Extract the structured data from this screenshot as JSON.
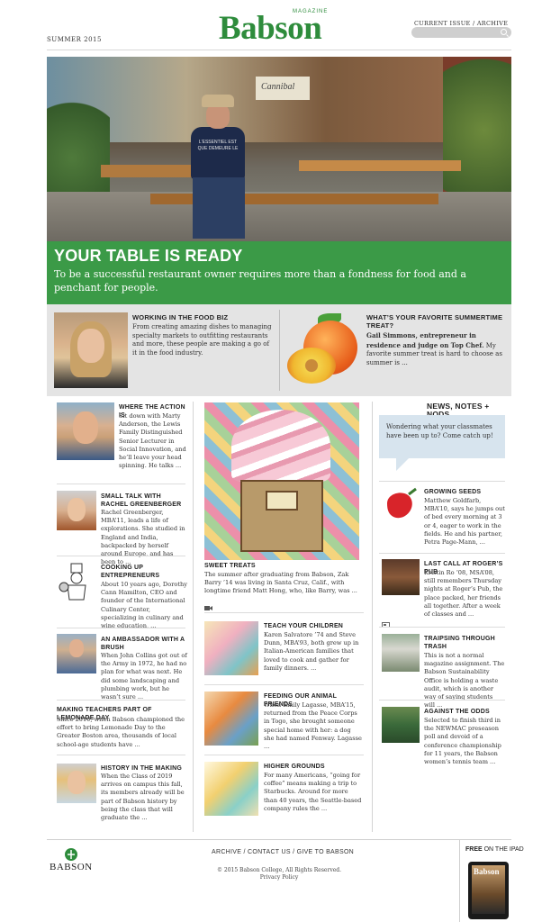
{
  "header": {
    "issue_date": "SUMMER 2015",
    "logo_magazine": "MAGAZINE",
    "logo_name": "Babson",
    "current_issue": "CURRENT ISSUE",
    "link_sep": "/",
    "archive": "ARCHIVE",
    "search_placeholder": ""
  },
  "hero": {
    "sign_text": "Cannibal",
    "shirt_text": "L'ESSENTIEL EST QUE DEMEURE LE",
    "title": "YOUR TABLE IS READY",
    "subtitle": "To be a successful restaurant owner requires more than a fondness for food and a penchant for people."
  },
  "features": [
    {
      "title": "WORKING IN THE FOOD BIZ",
      "text": "From creating amazing dishes to managing specialty markets to outfitting restaurants and more, these people are making a go of it in the food industry."
    },
    {
      "title": "WHAT’S YOUR FAVORITE SUMMERTIME TREAT?",
      "lead": "Gail Simmons, entrepreneur in residence and judge on Top Chef.",
      "text": " My favorite summer treat is hard to choose as summer is ..."
    }
  ],
  "left_col": [
    {
      "title": "WHERE THE ACTION IS",
      "text": "Sit down with Marty Anderson, the Lewis Family Distinguished Senior Lecturer in Social Innovation, and he’ll leave your head spinning. He talks ..."
    },
    {
      "title": "SMALL TALK WITH RACHEL GREENBERGER",
      "text": "Rachel Greenberger, MBA’11, leads a life of explorations. She studied in England and India, backpacked by herself around Europe, and has been to ..."
    },
    {
      "title": "COOKING UP ENTREPRENEURS",
      "text": "About 10 years ago, Dorothy Cann Hamilton, CEO and founder of the International Culinary Center, specializing in culinary and wine education, ..."
    },
    {
      "title": "AN AMBASSADOR WITH A BRUSH",
      "text": "When John Collins got out of the Army in 1972, he had no plan for what was next. He did some landscaping and plumbing work, but he wasn’t sure ..."
    },
    {
      "title": "MAKING TEACHERS PART OF LEMONADE DAY",
      "text": "Since 2010, when Babson championed the effort to bring Lemonade Day to the Greater Boston area, thousands of local school-age students have ..."
    },
    {
      "title": "HISTORY IN THE MAKING",
      "text": "When the Class of 2019 arrives on campus this fall, its members already will be part of Babson history by being the class that will graduate the ..."
    }
  ],
  "mid_col": [
    {
      "title": "SWEET TREATS",
      "text": "The summer after graduating from Babson, Zak Barry ’14 was living in Santa Cruz, Calif., with longtime friend Matt Hong, who, like Barry, was ..."
    },
    {
      "title": "TEACH YOUR CHILDREN",
      "text": "Karen Salvatore ’74 and Steve Dunn, MBA’93, both grew up in Italian-American families that loved to cook and gather for family dinners. ..."
    },
    {
      "title": "FEEDING OUR ANIMAL FRIENDS",
      "text": "When Emily Lagasse, MBA’15, returned from the Peace Corps in Togo, she brought someone special home with her: a dog she had named Fenway. Lagasse ..."
    },
    {
      "title": "HIGHER GROUNDS",
      "text": "For many Americans, “going for coffee” means making a trip to Starbucks. Around for more than 40 years, the Seattle-based company rules the ..."
    }
  ],
  "right_col": {
    "heading": "NEWS, NOTES + NODS",
    "bubble": "Wondering what your classmates have been up to? Come catch up!",
    "items": [
      {
        "title": "GROWING SEEDS",
        "text": "Matthew Goldfarb, MBA’10, says he jumps out of bed every morning at 3 or 4, eager to work in the fields. He and his partner, Petra Page-Mann, ..."
      },
      {
        "title": "LAST CALL AT ROGER’S PUB",
        "text": "Kristin Ro ’08, MSA’08, still remembers Thursday nights at Roger’s Pub, the place packed, her friends all together. After a week of classes and ..."
      },
      {
        "title": "TRAIPSING THROUGH TRASH",
        "text": "This is not a normal magazine assignment. The Babson Sustainability Office is holding a waste audit, which is another way of saying students will ..."
      },
      {
        "title": "AGAINST THE ODDS",
        "text": "Selected to finish third in the NEWMAC preseason poll and devoid of a conference championship for 11 years, the Babson women’s tennis team ..."
      }
    ]
  },
  "footer": {
    "logo_text": "BABSON",
    "links": [
      "ARCHIVE",
      "CONTACT US",
      "GIVE TO BABSON"
    ],
    "link_sep": "/",
    "copyright": "© 2015 Babson College, All Rights Reserved.",
    "privacy": "Privacy Policy",
    "ipad_free": "FREE",
    "ipad_rest": " ON THE IPAD",
    "ipad_logo": "Babson"
  },
  "colors": {
    "brand_green": "#2e8c3c",
    "band_green": "#3b9a47",
    "feature_gray": "#e4e4e4"
  }
}
